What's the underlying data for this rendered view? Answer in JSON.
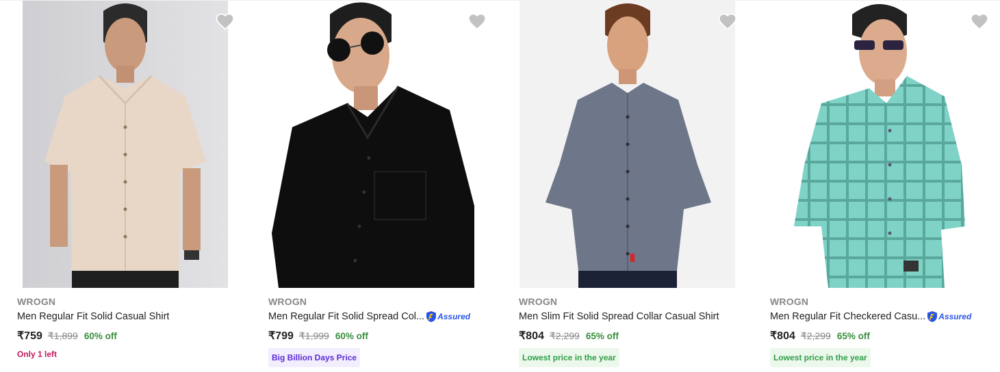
{
  "currency_symbol": "₹",
  "colors": {
    "wishlist_heart": "#c2c2c2",
    "discount": "#388e3c",
    "stock_alert": "#c2185b",
    "assured": "#2a55e5",
    "big_billion_tag": "#5b2bd6",
    "lowest_price_tag": "#2e9d47"
  },
  "products": [
    {
      "brand": "WROGN",
      "title": "Men Regular Fit Solid Casual Shirt",
      "assured": "",
      "price": "₹759",
      "mrp": "₹1,899",
      "discount": "60% off",
      "stock_note": "Only 1 left",
      "tag": "",
      "image_icon": "beige-shirt-photo",
      "wishlist_icon": "heart-icon"
    },
    {
      "brand": "WROGN",
      "title": "Men Regular Fit Solid Spread Col...",
      "assured": "Assured",
      "price": "₹799",
      "mrp": "₹1,999",
      "discount": "60% off",
      "stock_note": "",
      "tag": "Big Billion Days Price",
      "image_icon": "black-shirt-photo",
      "wishlist_icon": "heart-icon"
    },
    {
      "brand": "WROGN",
      "title": "Men Slim Fit Solid Spread Collar Casual Shirt",
      "assured": "",
      "price": "₹804",
      "mrp": "₹2,299",
      "discount": "65% off",
      "stock_note": "",
      "tag": "Lowest price in the year",
      "image_icon": "grey-shirt-photo",
      "wishlist_icon": "heart-icon"
    },
    {
      "brand": "WROGN",
      "title": "Men Regular Fit Checkered Casu...",
      "assured": "Assured",
      "price": "₹804",
      "mrp": "₹2,299",
      "discount": "65% off",
      "stock_note": "",
      "tag": "Lowest price in the year",
      "image_icon": "teal-checkered-shirt-photo",
      "wishlist_icon": "heart-icon"
    }
  ]
}
